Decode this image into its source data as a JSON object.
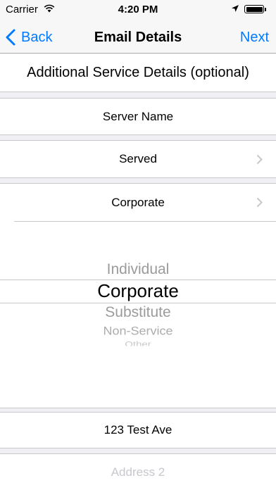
{
  "status_bar": {
    "carrier": "Carrier",
    "time": "4:20 PM",
    "battery_level": 1.0,
    "icons": [
      "wifi-icon",
      "location-arrow-icon",
      "battery-icon"
    ]
  },
  "nav": {
    "back_label": "Back",
    "title": "Email Details",
    "next_label": "Next"
  },
  "section_header": "Additional Service Details (optional)",
  "fields": {
    "server_name_placeholder": "Server Name",
    "served_value": "Served",
    "service_type_value": "Corporate",
    "address1_value": "123 Test Ave",
    "address2_placeholder": "Address 2"
  },
  "picker": {
    "options": [
      "Individual",
      "Corporate",
      "Substitute",
      "Non-Service",
      "Other"
    ],
    "selected": "Corporate"
  },
  "colors": {
    "accent": "#007aff",
    "background": "#efeff4",
    "separator": "#c8c7cc",
    "placeholder": "#c7c7cd"
  }
}
